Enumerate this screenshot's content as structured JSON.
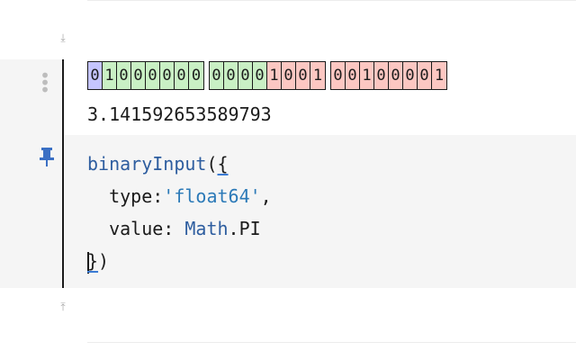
{
  "cell": {
    "output": {
      "bytes": [
        {
          "bits": [
            {
              "v": "0",
              "kind": "sign"
            },
            {
              "v": "1",
              "kind": "exp"
            },
            {
              "v": "0",
              "kind": "exp"
            },
            {
              "v": "0",
              "kind": "exp"
            },
            {
              "v": "0",
              "kind": "exp"
            },
            {
              "v": "0",
              "kind": "exp"
            },
            {
              "v": "0",
              "kind": "exp"
            },
            {
              "v": "0",
              "kind": "exp"
            }
          ]
        },
        {
          "bits": [
            {
              "v": "0",
              "kind": "exp"
            },
            {
              "v": "0",
              "kind": "exp"
            },
            {
              "v": "0",
              "kind": "exp"
            },
            {
              "v": "0",
              "kind": "exp"
            },
            {
              "v": "1",
              "kind": "man"
            },
            {
              "v": "0",
              "kind": "man"
            },
            {
              "v": "0",
              "kind": "man"
            },
            {
              "v": "1",
              "kind": "man"
            }
          ]
        },
        {
          "bits": [
            {
              "v": "0",
              "kind": "man"
            },
            {
              "v": "0",
              "kind": "man"
            },
            {
              "v": "1",
              "kind": "man"
            },
            {
              "v": "0",
              "kind": "man"
            },
            {
              "v": "0",
              "kind": "man"
            },
            {
              "v": "0",
              "kind": "man"
            },
            {
              "v": "0",
              "kind": "man"
            },
            {
              "v": "1",
              "kind": "man"
            }
          ]
        }
      ],
      "value_text": "3.141592653589793"
    },
    "code": {
      "fn_name": "binaryInput",
      "open": "({",
      "line2_key": "  type:",
      "line2_val": "'float64'",
      "line2_end": ",",
      "line3_key": "  value: ",
      "line3_obj": "Math",
      "line3_end": ".PI",
      "close": "})"
    },
    "colors": {
      "sign": "#c5c5ff",
      "exponent": "#c9f0c4",
      "mantissa": "#fcc7c2"
    }
  },
  "icons": {
    "collapse_top": "arrow-down-to-line-icon",
    "drag_handle": "drag-dots-icon",
    "pin": "pin-icon",
    "collapse_bottom": "arrow-up-from-line-icon"
  }
}
